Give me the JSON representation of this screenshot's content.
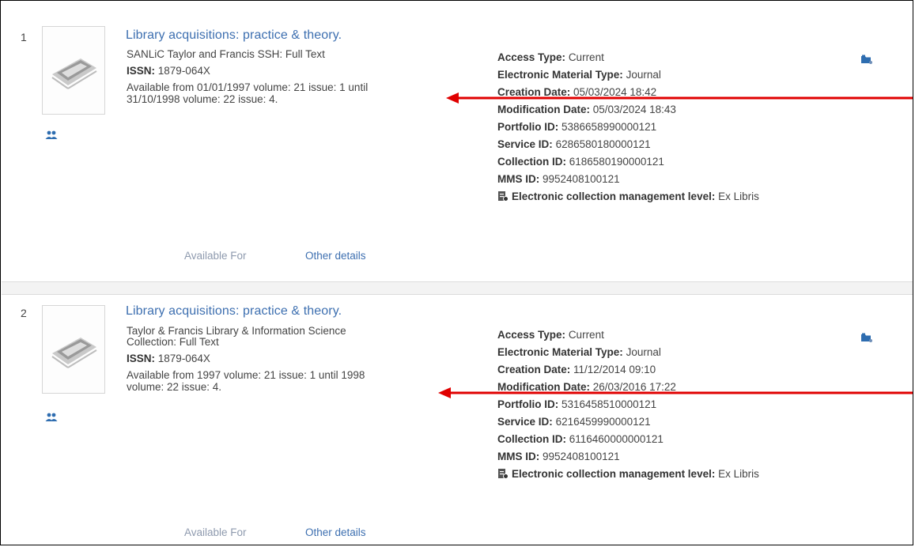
{
  "results": [
    {
      "index": "1",
      "title": "Library acquisitions: practice & theory.",
      "collection_lines": [
        "SANLiC Taylor and Francis SSH: Full Text"
      ],
      "issn_label": "ISSN:",
      "issn": "1879-064X",
      "availability_lines": [
        "Available from 01/01/1997 volume: 21 issue: 1 until",
        "31/10/1998 volume: 22 issue: 4."
      ],
      "details": [
        {
          "label": "Access Type:",
          "value": "Current"
        },
        {
          "label": "Electronic Material Type:",
          "value": "Journal"
        },
        {
          "label": "Creation Date:",
          "value": "05/03/2024 18:42"
        },
        {
          "label": "Modification Date:",
          "value": "05/03/2024 18:43"
        },
        {
          "label": "Portfolio ID:",
          "value": "5386658990000121"
        },
        {
          "label": "Service ID:",
          "value": "6286580180000121"
        },
        {
          "label": "Collection ID:",
          "value": "6186580190000121"
        },
        {
          "label": "MMS ID:",
          "value": "9952408100121"
        },
        {
          "label": "Electronic collection management level:",
          "value": "Ex Libris"
        }
      ],
      "link_available_for": "Available For",
      "link_other_details": "Other details"
    },
    {
      "index": "2",
      "title": "Library acquisitions: practice & theory.",
      "collection_lines": [
        "Taylor & Francis Library & Information Science",
        "Collection: Full Text"
      ],
      "issn_label": "ISSN:",
      "issn": "1879-064X",
      "availability_lines": [
        "Available from 1997 volume: 21 issue: 1 until 1998",
        "volume: 22 issue: 4."
      ],
      "details": [
        {
          "label": "Access Type:",
          "value": "Current"
        },
        {
          "label": "Electronic Material Type:",
          "value": "Journal"
        },
        {
          "label": "Creation Date:",
          "value": "11/12/2014 09:10"
        },
        {
          "label": "Modification Date:",
          "value": "26/03/2016 17:22"
        },
        {
          "label": "Portfolio ID:",
          "value": "5316458510000121"
        },
        {
          "label": "Service ID:",
          "value": "6216459990000121"
        },
        {
          "label": "Collection ID:",
          "value": "6116460000000121"
        },
        {
          "label": "MMS ID:",
          "value": "9952408100121"
        },
        {
          "label": "Electronic collection management level:",
          "value": "Ex Libris"
        }
      ],
      "link_available_for": "Available For",
      "link_other_details": "Other details"
    }
  ],
  "icons": {
    "thumbnail": "journal-thumbnail-icon",
    "people": "people-icon",
    "folder": "folder-icon",
    "management_level": "collection-management-icon",
    "annotation_arrow": "red-arrow"
  },
  "colors": {
    "link": "#3d6fb0",
    "muted_link": "#8e9aae",
    "arrow": "#e00000"
  }
}
